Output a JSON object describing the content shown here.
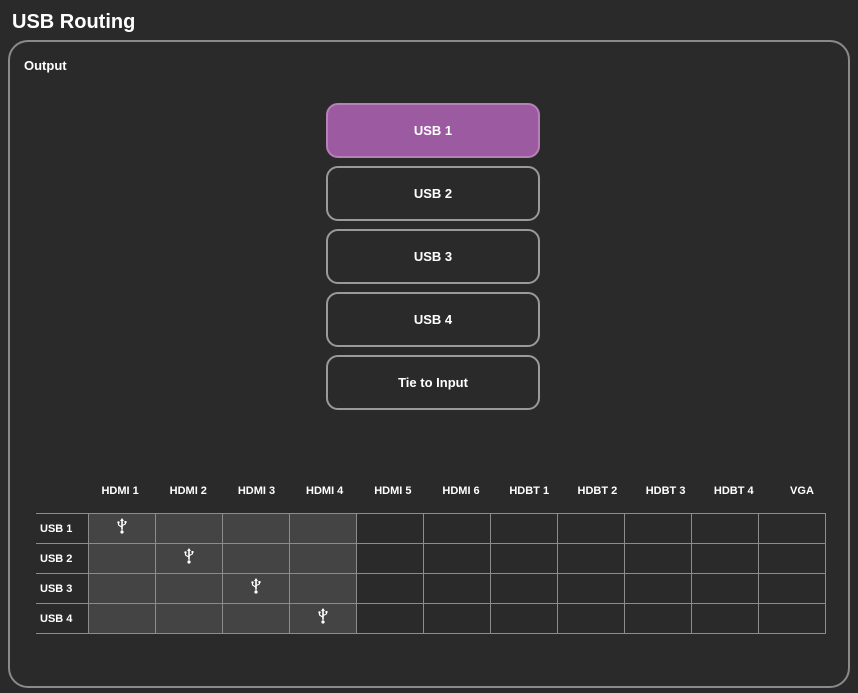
{
  "page": {
    "title": "USB Routing"
  },
  "output_panel": {
    "title": "Output",
    "buttons": [
      {
        "label": "USB 1",
        "selected": true
      },
      {
        "label": "USB 2",
        "selected": false
      },
      {
        "label": "USB 3",
        "selected": false
      },
      {
        "label": "USB 4",
        "selected": false
      },
      {
        "label": "Tie to Input",
        "selected": false
      }
    ]
  },
  "matrix": {
    "columns": [
      "HDMI 1",
      "HDMI 2",
      "HDMI 3",
      "HDMI 4",
      "HDMI 5",
      "HDMI 6",
      "HDBT 1",
      "HDBT 2",
      "HDBT 3",
      "HDBT 4",
      "VGA"
    ],
    "rows": [
      "USB 1",
      "USB 2",
      "USB 3",
      "USB 4"
    ],
    "connections": [
      {
        "row": "USB 1",
        "column": "HDMI 1"
      },
      {
        "row": "USB 2",
        "column": "HDMI 2"
      },
      {
        "row": "USB 3",
        "column": "HDMI 3"
      },
      {
        "row": "USB 4",
        "column": "HDMI 4"
      }
    ],
    "enabled_columns": [
      "HDMI 1",
      "HDMI 2",
      "HDMI 3",
      "HDMI 4"
    ],
    "icon": "usb-icon"
  },
  "colors": {
    "background": "#2a2a2a",
    "accent": "#9c5aa0",
    "shaded_cell": "#444444",
    "border": "#8a8a8a"
  }
}
